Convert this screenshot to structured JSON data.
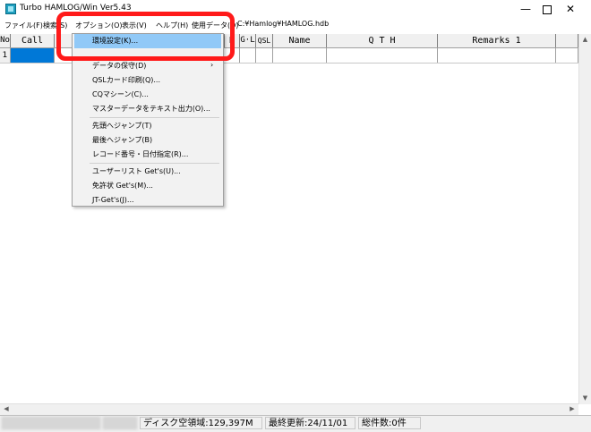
{
  "window": {
    "title": "Turbo HAMLOG/Win Ver5.43",
    "minimize_icon": "minimize-icon",
    "maximize_icon": "maximize-icon",
    "close_icon": "close-icon"
  },
  "menubar": {
    "items": [
      "ファイル(F)",
      "検索(S)",
      "オプション(O)",
      "表示(V)",
      "ヘルプ(H)",
      "使用データ(D)"
    ],
    "path": "C:¥Hamlog¥HAMLOG.hdb"
  },
  "grid": {
    "columns": [
      "No",
      "Call",
      "",
      "D",
      "G·L",
      "QSL",
      "Name",
      "Q T H",
      "Remarks 1"
    ],
    "row_number": "1"
  },
  "dropdown": {
    "items": [
      {
        "label": "環境設定(K)..."
      },
      {
        "label": "データの保守(D)",
        "submenu": "›"
      },
      {
        "label": "QSLカード印刷(Q)..."
      },
      {
        "label": "CQマシーン(C)..."
      },
      {
        "label": "マスターデータをテキスト出力(O)..."
      },
      {
        "label": "先頭へジャンプ(T)"
      },
      {
        "label": "最後へジャンプ(B)"
      },
      {
        "label": "レコード番号・日付指定(R)..."
      },
      {
        "label": "ユーザーリスト Get's(U)..."
      },
      {
        "label": "免許状 Get's(M)..."
      },
      {
        "label": "JT-Get's(J)..."
      }
    ]
  },
  "statusbar": {
    "disk": "ディスク空領域:129,397M",
    "updated": "最終更新:24/11/01",
    "total": "総件数:0件"
  },
  "colors": {
    "highlight": "#ff1a1a",
    "selected_menu": "#91c9f7",
    "row_cell": "#0078d7"
  }
}
